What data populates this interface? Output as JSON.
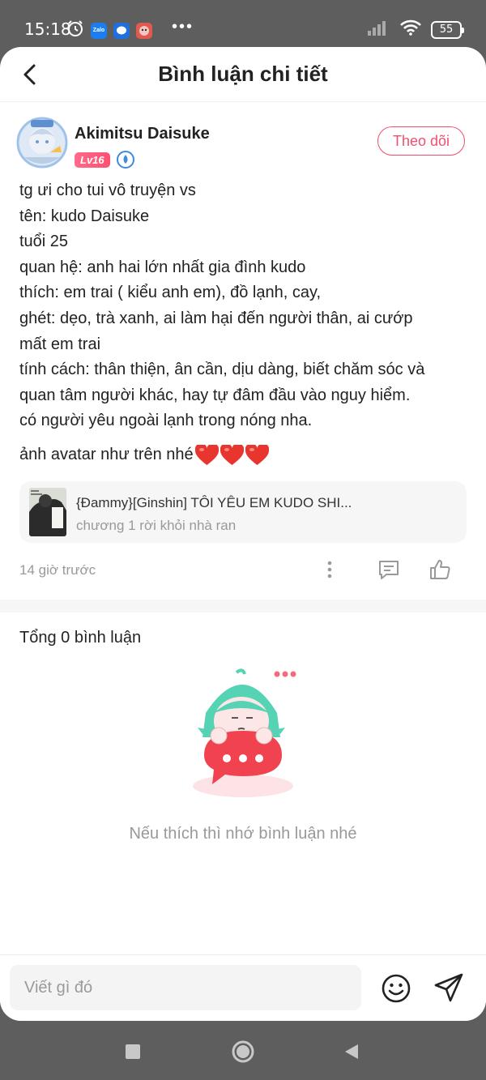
{
  "status_bar": {
    "time": "15:18",
    "apps": [
      "Zalo"
    ],
    "more": "•••",
    "battery": "55"
  },
  "header": {
    "title": "Bình luận chi tiết"
  },
  "comment": {
    "author": "Akimitsu Daisuke",
    "level": "Lv16",
    "follow_label": "Theo dõi",
    "lines": [
      "tg ưi cho tui vô truyện vs",
      "tên: kudo Daisuke",
      "tuổi 25",
      "quan hệ: anh hai lớn nhất gia đình kudo",
      "thích: em trai ( kiểu anh em), đồ lạnh, cay,",
      "ghét: dẹo, trà xanh, ai làm hại đến người thân, ai cướp",
      "mất em trai",
      "tính cách: thân thiện, ân cần, dịu dàng, biết chăm sóc và",
      "quan tâm người khác, hay tự đâm đầu vào nguy hiểm.",
      "có người yêu ngoài lạnh trong nóng nha."
    ],
    "extra_line": "ảnh avatar như trên nhé",
    "hearts": [
      "❤",
      "❤",
      "❤"
    ],
    "book": {
      "title": "{Đammy}[Ginshin] TÔI YÊU EM KUDO SHI...",
      "chapter": "chương 1 rời khỏi nhà ran"
    },
    "time_ago": "14 giờ trước"
  },
  "replies": {
    "total_label": "Tổng 0 bình luận",
    "empty_text": "Nếu thích thì nhớ bình luận nhé"
  },
  "input": {
    "placeholder": "Viết gì đó"
  },
  "colors": {
    "accent": "#f0506e",
    "background": "#5e5e5e",
    "muted": "#999999"
  }
}
